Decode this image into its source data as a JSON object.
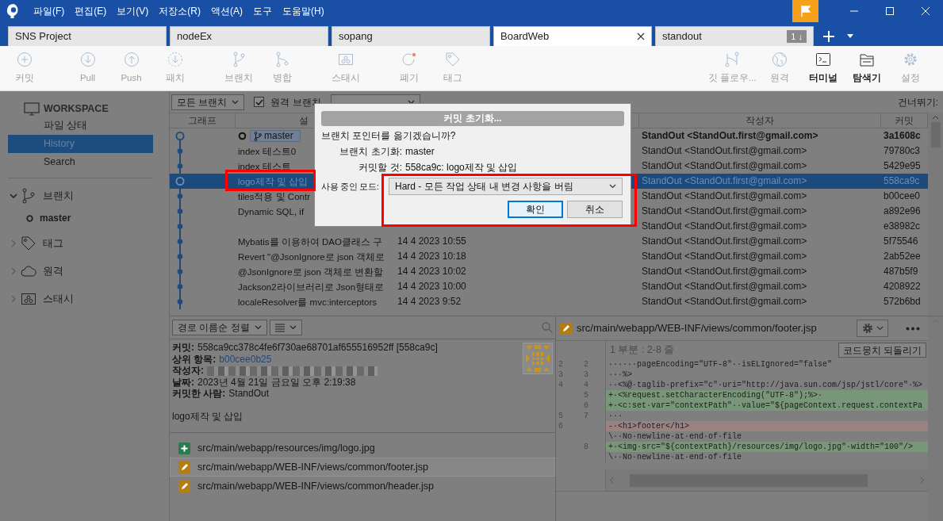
{
  "title_bar": {
    "menus": [
      "파일(F)",
      "편집(E)",
      "보기(V)",
      "저장소(R)",
      "액션(A)",
      "도구",
      "도움말(H)"
    ]
  },
  "repo_tabs": [
    {
      "label": "SNS Project",
      "selected": false
    },
    {
      "label": "nodeEx",
      "selected": false
    },
    {
      "label": "sopang",
      "selected": false
    },
    {
      "label": "BoardWeb",
      "selected": true
    },
    {
      "label": "standout",
      "selected": false,
      "badge": "1 ↓"
    }
  ],
  "toolbar": {
    "groups": [
      {
        "items": [
          {
            "label": "커밋",
            "enabled": false
          }
        ]
      },
      {
        "items": [
          {
            "label": "Pull",
            "enabled": false
          },
          {
            "label": "Push",
            "enabled": false
          },
          {
            "label": "패치",
            "enabled": false
          }
        ]
      },
      {
        "items": [
          {
            "label": "브랜치",
            "enabled": false
          },
          {
            "label": "병합",
            "enabled": false
          }
        ]
      },
      {
        "items": [
          {
            "label": "스태시",
            "enabled": false
          }
        ]
      },
      {
        "items": [
          {
            "label": "폐기",
            "enabled": false
          },
          {
            "label": "태그",
            "enabled": false
          }
        ]
      }
    ],
    "right_items": [
      {
        "label": "깃 플로우...",
        "enabled": false
      },
      {
        "label": "원격",
        "enabled": false
      },
      {
        "label": "터미널",
        "enabled": true
      },
      {
        "label": "탐색기",
        "enabled": true
      },
      {
        "label": "설정",
        "enabled": false
      }
    ]
  },
  "sidebar": {
    "workspace": "WORKSPACE",
    "items": [
      {
        "label": "파일 상태",
        "selected": false
      },
      {
        "label": "History",
        "selected": true
      },
      {
        "label": "Search",
        "selected": false
      }
    ],
    "sections": [
      {
        "label": "브랜치",
        "expanded": true,
        "children": [
          {
            "label": "master",
            "current": true
          }
        ]
      },
      {
        "label": "태그",
        "expanded": false
      },
      {
        "label": "원격",
        "expanded": false
      },
      {
        "label": "스태시",
        "expanded": false
      }
    ]
  },
  "commit_filter": {
    "branches": "모든 브랜치",
    "remote_checkbox": {
      "label": "원격 브랜치",
      "checked": true
    },
    "skip_label": "건너뛰기:"
  },
  "commit_table": {
    "columns": [
      "그래프",
      "설",
      "작성자",
      "커밋"
    ],
    "rows": [
      {
        "tags": [
          "master"
        ],
        "author": "StandOut <StandOut.first@gmail.com>",
        "commit": "3a1608c",
        "head": true,
        "selected": false
      },
      {
        "description": "index 테스트0",
        "author": "StandOut <StandOut.first@gmail.com>",
        "commit": "79780c3",
        "head": false,
        "selected": false
      },
      {
        "description": "index 테스트",
        "author": "StandOut <StandOut.first@gmail.com>",
        "commit": "5429e95",
        "head": false,
        "selected": false
      },
      {
        "description": "logo제작 및 삽입",
        "author": "StandOut <StandOut.first@gmail.com>",
        "commit": "558ca9c",
        "head": false,
        "selected": true
      },
      {
        "description": "tiles적용 및 Contr",
        "author": "StandOut <StandOut.first@gmail.com>",
        "commit": "b00cee0",
        "head": false,
        "selected": false
      },
      {
        "description": "Dynamic SQL, if",
        "author": "StandOut <StandOut.first@gmail.com>",
        "commit": "a892e96",
        "head": false,
        "selected": false
      },
      {
        "author": "StandOut <StandOut.first@gmail.com>",
        "commit": "e38982c",
        "head": false,
        "selected": false
      },
      {
        "description": "Mybatis를 이용하여 DAO클래스 구",
        "date": "14 4 2023 10:55",
        "author": "StandOut <StandOut.first@gmail.com>",
        "commit": "5f75546",
        "head": false,
        "selected": false
      },
      {
        "description": "Revert \"@JsonIgnore로 json 객체로",
        "date": "14 4 2023 10:18",
        "author": "StandOut <StandOut.first@gmail.com>",
        "commit": "2ab52ee",
        "head": false,
        "selected": false
      },
      {
        "description": "@JsonIgnore로 json 객체로 변환할",
        "date": "14 4 2023 10:02",
        "author": "StandOut <StandOut.first@gmail.com>",
        "commit": "487b5f9",
        "head": false,
        "selected": false
      },
      {
        "description": "Jackson2라이브러리로 Json형태로",
        "date": "14 4 2023 10:00",
        "author": "StandOut <StandOut.first@gmail.com>",
        "commit": "4208922",
        "head": false,
        "selected": false
      },
      {
        "description": "localeResolver를 mvc:interceptors",
        "date": "14 4 2023 9:52",
        "author": "StandOut <StandOut.first@gmail.com>",
        "commit": "572b6bd",
        "head": false,
        "selected": false
      }
    ]
  },
  "details_panel": {
    "sort": "경로 이름순 정렬",
    "details": [
      {
        "label": "커밋:",
        "value": "558ca9cc378c4fe6f730ae68701af655516952ff [558ca9c]"
      },
      {
        "label": "상위 항목:",
        "value": "b00cee0b25",
        "link": true
      },
      {
        "label": "작성자:",
        "redacted": true
      },
      {
        "label": "날짜:",
        "value": "2023년 4월 21일 금요일 오후 2:19:38"
      },
      {
        "label": "커밋한 사람:",
        "value": "StandOut"
      }
    ],
    "message": "logo제작 및 삽입",
    "files": [
      {
        "path": "src/main/webapp/resources/img/logo.jpg",
        "kind": "added",
        "selected": false
      },
      {
        "path": "src/main/webapp/WEB-INF/views/common/footer.jsp",
        "kind": "modified",
        "selected": true
      },
      {
        "path": "src/main/webapp/WEB-INF/views/common/header.jsp",
        "kind": "modified",
        "selected": false
      }
    ]
  },
  "diff": {
    "path": "src/main/webapp/WEB-INF/views/common/footer.jsp",
    "kind": "modified",
    "hunk": "1 부분 : 2-8 줄",
    "revert_button": "코드뭉치 되돌리기",
    "lines": [
      {
        "old": "2",
        "new": "2",
        "kind": "context",
        "text": "······pageEncoding=\"UTF-8\"··isELIgnored=\"false\""
      },
      {
        "old": "3",
        "new": "3",
        "kind": "context",
        "text": "···%>"
      },
      {
        "old": "4",
        "new": "4",
        "kind": "context",
        "text": "··<%@·taglib·prefix=\"c\"·uri=\"http://java.sun.com/jsp/jstl/core\"·%>"
      },
      {
        "new": "5",
        "kind": "added",
        "text": "+·<%request.setCharacterEncoding(\"UTF-8\");%>·"
      },
      {
        "new": "6",
        "kind": "added",
        "text": "+·<c:set·var=\"contextPath\"··value=\"${pageContext.request.contextPa"
      },
      {
        "old": "5",
        "new": "7",
        "kind": "context",
        "text": "···"
      },
      {
        "old": "6",
        "kind": "removed",
        "text": "-·<h1>footer</h1>"
      },
      {
        "kind": "context",
        "text": "\\··No·newline·at·end·of·file"
      },
      {
        "new": "8",
        "kind": "added",
        "text": "+·<img·src=\"${contextPath}/resources/img/logo.jpg\"·width=\"100\"/>"
      },
      {
        "kind": "context",
        "text": "\\··No·newline·at·end·of·file"
      }
    ]
  },
  "dialog": {
    "title": "커밋 초기화...",
    "question": "브랜치 포인터를 옮기겠습니까?",
    "fields": [
      {
        "label": "브랜치 초기화:",
        "value": "master"
      },
      {
        "label": "커밋할 것:",
        "value": "558ca9c: logo제작 및 삽입"
      }
    ],
    "mode_label": "사용 중인 모드:",
    "mode": "Hard - 모든 작업 상태 내 변경 사항을 버림",
    "buttons": [
      {
        "label": "확인",
        "default": true
      },
      {
        "label": "취소",
        "default": false
      }
    ]
  }
}
